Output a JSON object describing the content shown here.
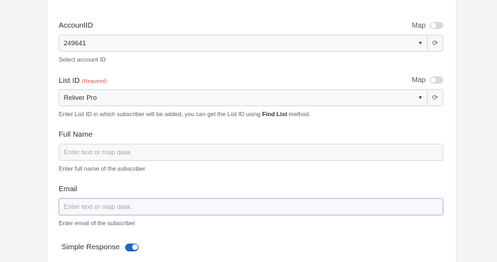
{
  "account": {
    "label": "AccountID",
    "map_label": "Map",
    "value": "249641",
    "help": "Select account ID"
  },
  "list": {
    "label": "List ID",
    "required": "(Required)",
    "map_label": "Map",
    "value": "Reliver Pro",
    "help_prefix": "Enter List ID in which subscriber will be added, you can get the List ID using ",
    "help_bold": "Find List",
    "help_suffix": " method."
  },
  "full_name": {
    "label": "Full Name",
    "placeholder": "Enter text or map data.",
    "help": "Enter full name of the subscriber"
  },
  "email": {
    "label": "Email",
    "placeholder": "Enter text or map data.",
    "help": "Enter email of the subscriber"
  },
  "simple_response": {
    "label": "Simple Response",
    "enabled": true
  },
  "colors": {
    "accent": "#1e67c7",
    "required": "#d9534f"
  }
}
